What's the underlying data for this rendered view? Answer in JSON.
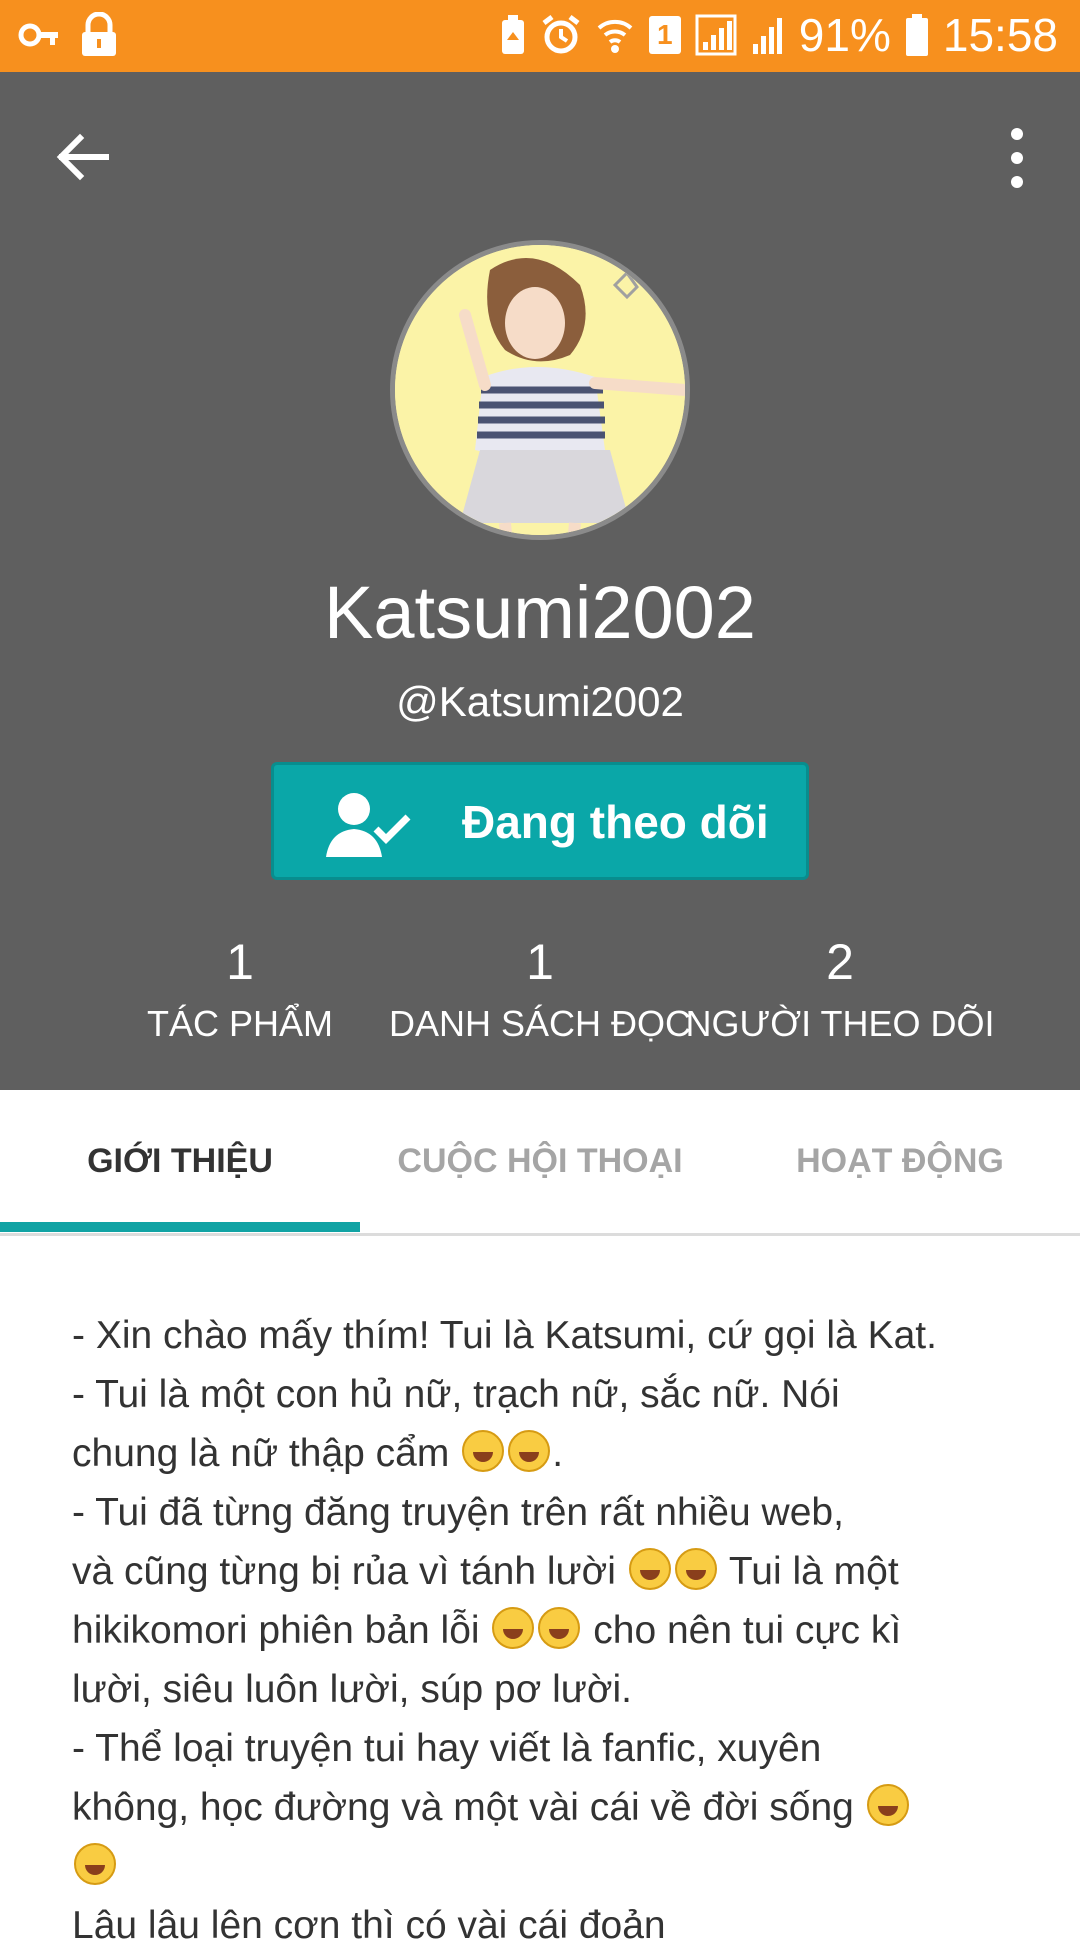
{
  "status_bar": {
    "battery_percent": "91%",
    "time": "15:58",
    "sim_slot": "1",
    "icons": [
      "key-icon",
      "lock-icon",
      "battery-saver-icon",
      "alarm-icon",
      "wifi-icon",
      "sim-icon",
      "signal-icon",
      "signal-icon-2",
      "battery-icon"
    ]
  },
  "header": {
    "back_icon": "arrow-left-icon",
    "more_icon": "more-vertical-icon"
  },
  "profile": {
    "name": "Katsumi2002",
    "handle": "@Katsumi2002",
    "follow_button_label": "Đang theo dõi",
    "follow_icon": "user-check-icon"
  },
  "stats": [
    {
      "value": "1",
      "label": "TÁC PHẨM"
    },
    {
      "value": "1",
      "label": "DANH SÁCH ĐỌC"
    },
    {
      "value": "2",
      "label": "NGƯỜI THEO DÕI"
    }
  ],
  "tabs": [
    {
      "label": "GIỚI THIỆU",
      "active": true
    },
    {
      "label": "CUỘC HỘI THOẠI",
      "active": false
    },
    {
      "label": "HOẠT ĐỘNG",
      "active": false
    }
  ],
  "about": {
    "line1": "- Xin chào mấy thím! Tui là Katsumi, cứ gọi là Kat.",
    "line2a": "- Tui là một con hủ nữ, trạch nữ, sắc nữ. Nói",
    "line2b": "chung là nữ thập cẩm",
    "line3a": "- Tui đã từng đăng truyện trên rất nhiều web,",
    "line3b": "và cũng từng bị rủa vì tánh lười",
    "line3c": "Tui là một",
    "line3d": "hikikomori phiên bản lỗi",
    "line3e": "cho nên tui cực kì",
    "line3f": "lười, siêu luôn lười, súp pơ lười.",
    "line4a": "- Thể loại truyện tui hay viết là fanfic, xuyên",
    "line4b": "không, học đường và một vài cái về đời sống",
    "line5": "Lâu lâu lên cơn thì có vài cái đoản"
  },
  "colors": {
    "status_bar": "#f7901e",
    "header_bg": "#5f5f5f",
    "accent": "#0aa7a8"
  }
}
